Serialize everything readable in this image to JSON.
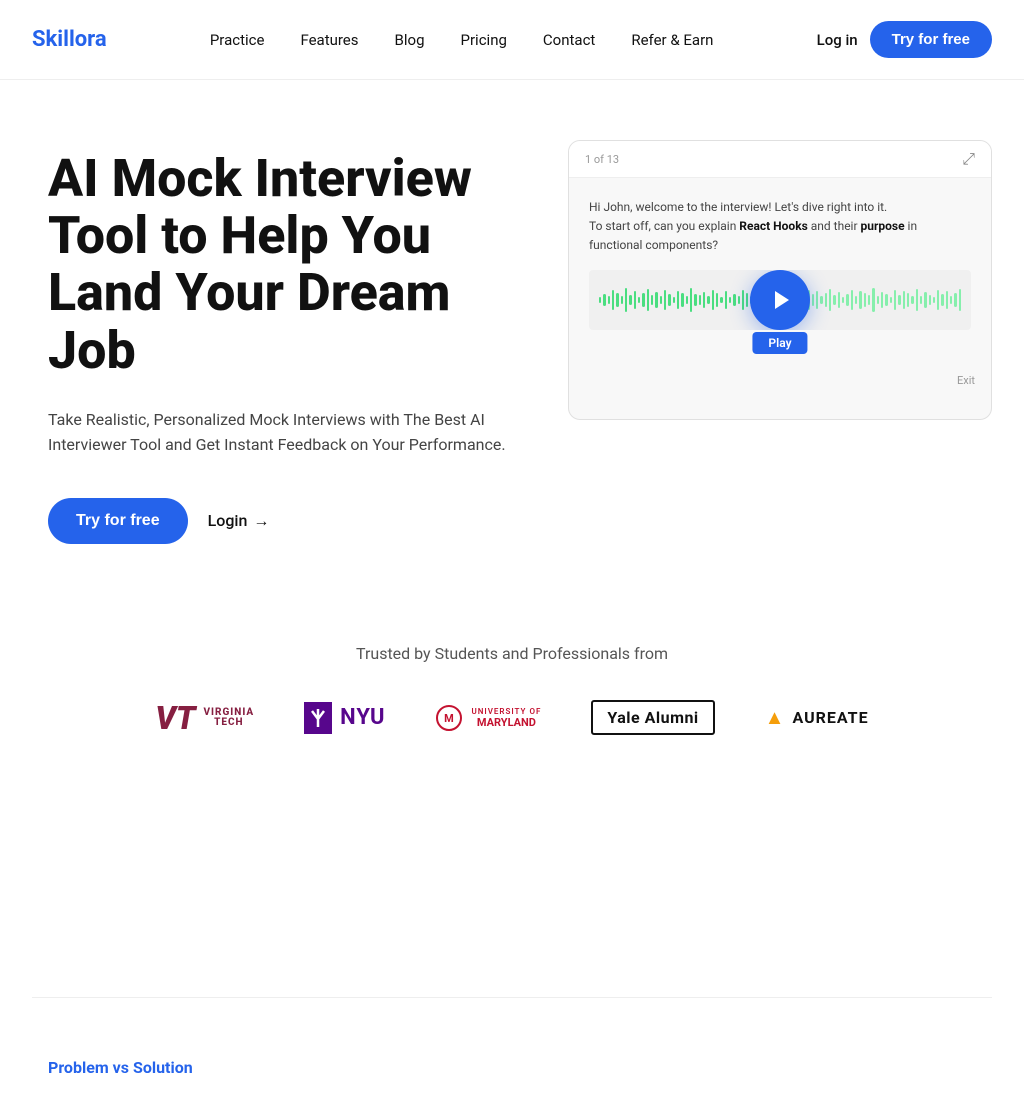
{
  "brand": {
    "name": "Skillora",
    "color": "#2563eb"
  },
  "nav": {
    "links": [
      {
        "id": "practice",
        "label": "Practice"
      },
      {
        "id": "features",
        "label": "Features"
      },
      {
        "id": "blog",
        "label": "Blog"
      },
      {
        "id": "pricing",
        "label": "Pricing"
      },
      {
        "id": "contact",
        "label": "Contact"
      },
      {
        "id": "refer",
        "label": "Refer & Earn"
      }
    ],
    "login_label": "Log in",
    "cta_label": "Try for free"
  },
  "hero": {
    "title": "AI Mock Interview Tool to Help You Land Your Dream Job",
    "subtitle": "Take Realistic, Personalized Mock Interviews with The Best AI Interviewer Tool and Get Instant Feedback on Your Performance.",
    "cta_label": "Try for free",
    "login_label": "Login",
    "video": {
      "counter": "1 of 13",
      "chat_text_line1": "Hi John, welcome to the interview! Let's dive right into it.",
      "chat_text_line2": "To start off, can you explain React Hooks and their purpose in functional components?",
      "play_label": "Play",
      "exit_label": "Exit"
    }
  },
  "trusted": {
    "text": "Trusted by Students and Professionals from",
    "logos": [
      {
        "id": "virginia-tech",
        "name": "Virginia Tech"
      },
      {
        "id": "nyu",
        "name": "NYU"
      },
      {
        "id": "umd",
        "name": "University of Maryland"
      },
      {
        "id": "yale",
        "name": "Yale Alumni"
      },
      {
        "id": "aureate",
        "name": "Aureate"
      }
    ]
  },
  "problem": {
    "section_label": "Problem vs Solution"
  }
}
